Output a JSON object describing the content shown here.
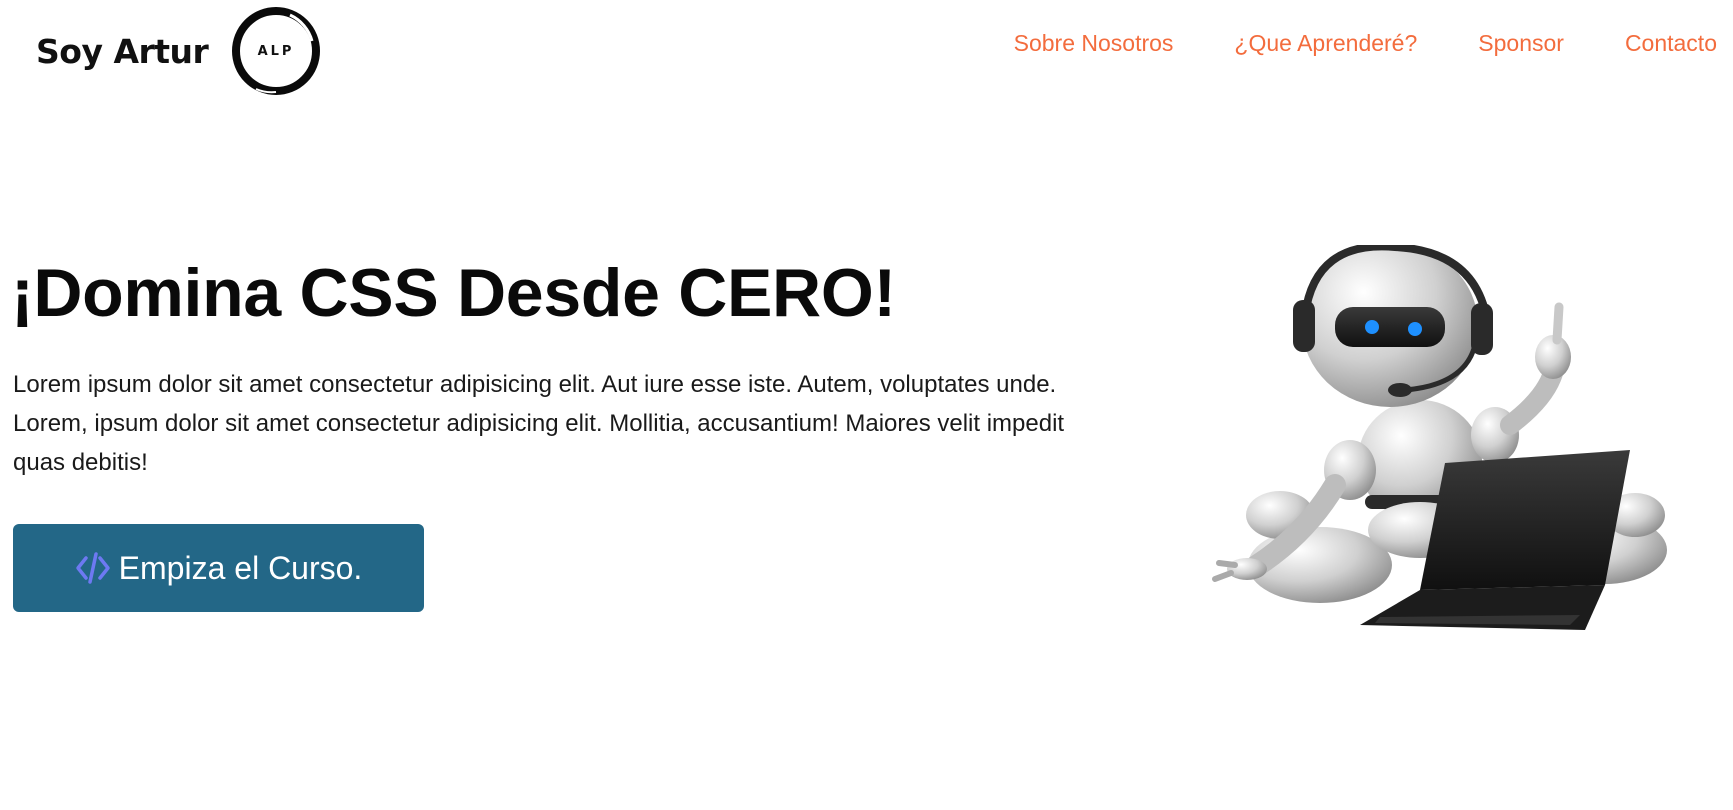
{
  "header": {
    "logo_text": "Soy Artur",
    "logo_mark_text": "ALP",
    "nav": [
      {
        "label": "Sobre Nosotros"
      },
      {
        "label": "¿Que Aprenderé?"
      },
      {
        "label": "Sponsor"
      },
      {
        "label": "Contacto"
      }
    ]
  },
  "hero": {
    "title": "¡Domina CSS Desde CERO!",
    "description": "Lorem ipsum dolor sit amet consectetur adipisicing elit. Aut iure esse iste. Autem, voluptates unde. Lorem, ipsum dolor sit amet consectetur adipisicing elit. Mollitia, accusantium! Maiores velit impedit quas debitis!",
    "cta": {
      "label": "Empiza el Curso.",
      "icon": "code-icon"
    },
    "image": "robot-with-laptop-illustration"
  },
  "colors": {
    "nav_link": "#f36c3d",
    "button_bg": "#236787",
    "code_icon": "#6d79f2",
    "robot_eyes": "#1e90ff"
  }
}
